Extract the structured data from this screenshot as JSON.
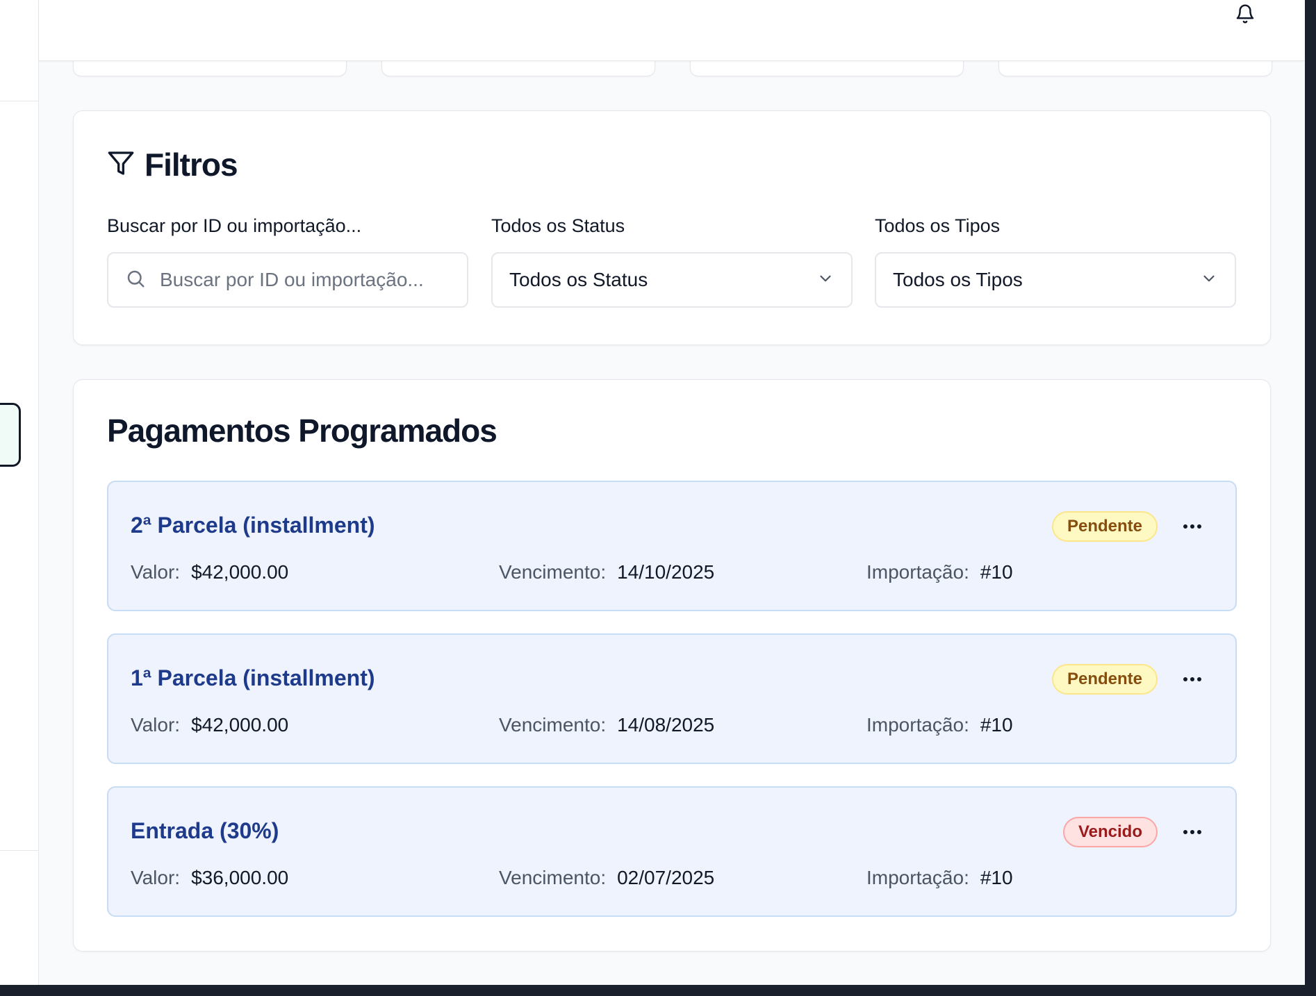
{
  "filters": {
    "title": "Filtros",
    "search": {
      "label": "Buscar por ID ou importação...",
      "placeholder": "Buscar por ID ou importação..."
    },
    "status": {
      "label": "Todos os Status",
      "value": "Todos os Status"
    },
    "type": {
      "label": "Todos os Tipos",
      "value": "Todos os Tipos"
    }
  },
  "payments": {
    "title": "Pagamentos Programados",
    "labels": {
      "value": "Valor:",
      "due": "Vencimento:",
      "import": "Importação:"
    },
    "items": [
      {
        "title": "2ª Parcela (installment)",
        "status": "Pendente",
        "value": "$42,000.00",
        "due": "14/10/2025",
        "import": "#10"
      },
      {
        "title": "1ª Parcela (installment)",
        "status": "Pendente",
        "value": "$42,000.00",
        "due": "14/08/2025",
        "import": "#10"
      },
      {
        "title": "Entrada (30%)",
        "status": "Vencido",
        "value": "$36,000.00",
        "due": "02/07/2025",
        "import": "#10"
      }
    ]
  },
  "icons": {
    "bell": "bell-icon",
    "filter": "filter-icon",
    "search": "search-icon",
    "chevron": "chevron-down-icon",
    "more": "more-horizontal-icon"
  },
  "colors": {
    "pending_bg": "#fef9c3",
    "pending_text": "#854d0e",
    "overdue_bg": "#fee2e2",
    "overdue_text": "#991b1b",
    "item_bg": "#eef3fd",
    "item_title": "#1e3a8a"
  }
}
